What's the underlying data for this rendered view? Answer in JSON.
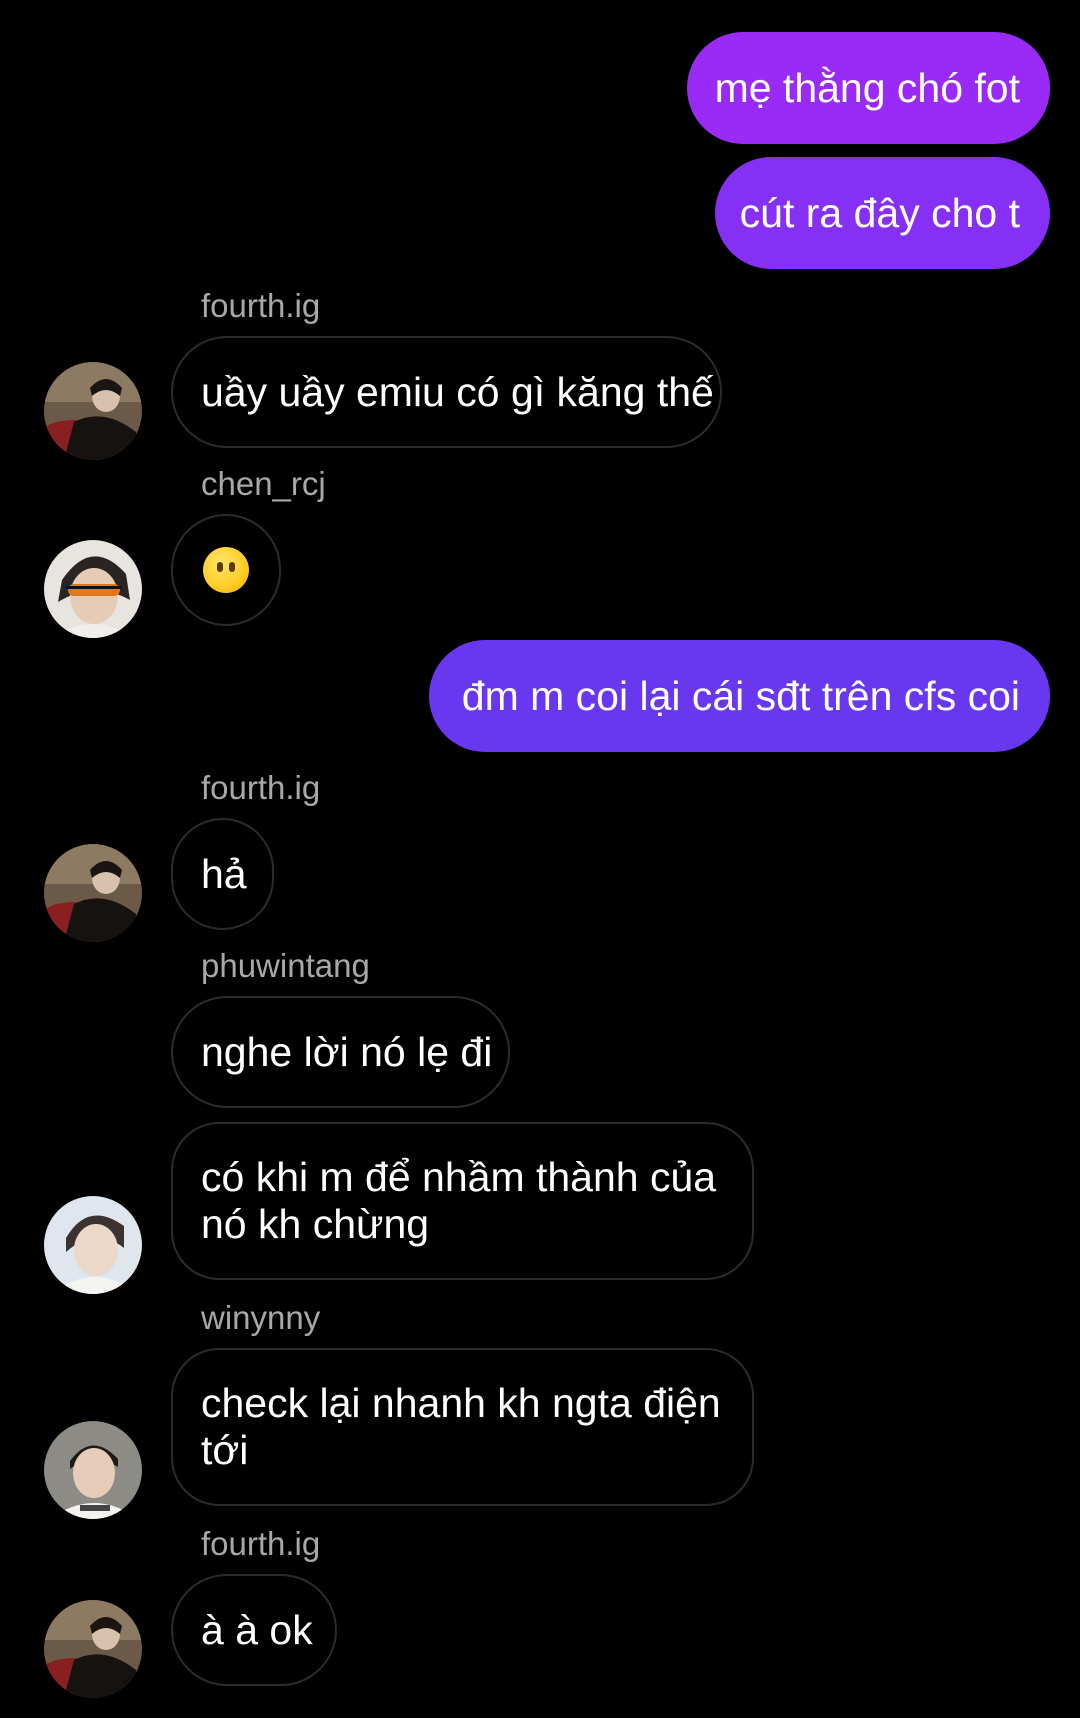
{
  "colors": {
    "background": "#000000",
    "outgoing_gradient_top": "#9b2cf6",
    "outgoing_gradient_bottom": "#6636f0",
    "incoming_border": "#2b2b2b",
    "sender_name": "#a8a8a8"
  },
  "messages": {
    "m1": {
      "text": "mẹ thằng chó fot",
      "direction": "outgoing"
    },
    "m2": {
      "text": "cút ra đây cho t",
      "direction": "outgoing"
    },
    "m3": {
      "sender": "fourth.ig",
      "text": "uầy uầy emiu có gì kăng thế",
      "direction": "incoming"
    },
    "m4": {
      "sender": "chen_rcj",
      "emoji": "neutral-face-no-mouth-emoji",
      "direction": "incoming"
    },
    "m5": {
      "text": "đm m coi lại cái sđt trên cfs coi",
      "direction": "outgoing"
    },
    "m6": {
      "sender": "fourth.ig",
      "text": "hả",
      "direction": "incoming"
    },
    "m7": {
      "sender": "phuwintang",
      "text": "nghe lời nó lẹ đi",
      "direction": "incoming"
    },
    "m8": {
      "text": "có khi m để nhầm thành của nó kh chừng",
      "direction": "incoming"
    },
    "m9": {
      "sender": "winynny",
      "text": "check lại nhanh kh ngta điện tới",
      "direction": "incoming"
    },
    "m10": {
      "sender": "fourth.ig",
      "text": "à à ok",
      "direction": "incoming"
    }
  }
}
